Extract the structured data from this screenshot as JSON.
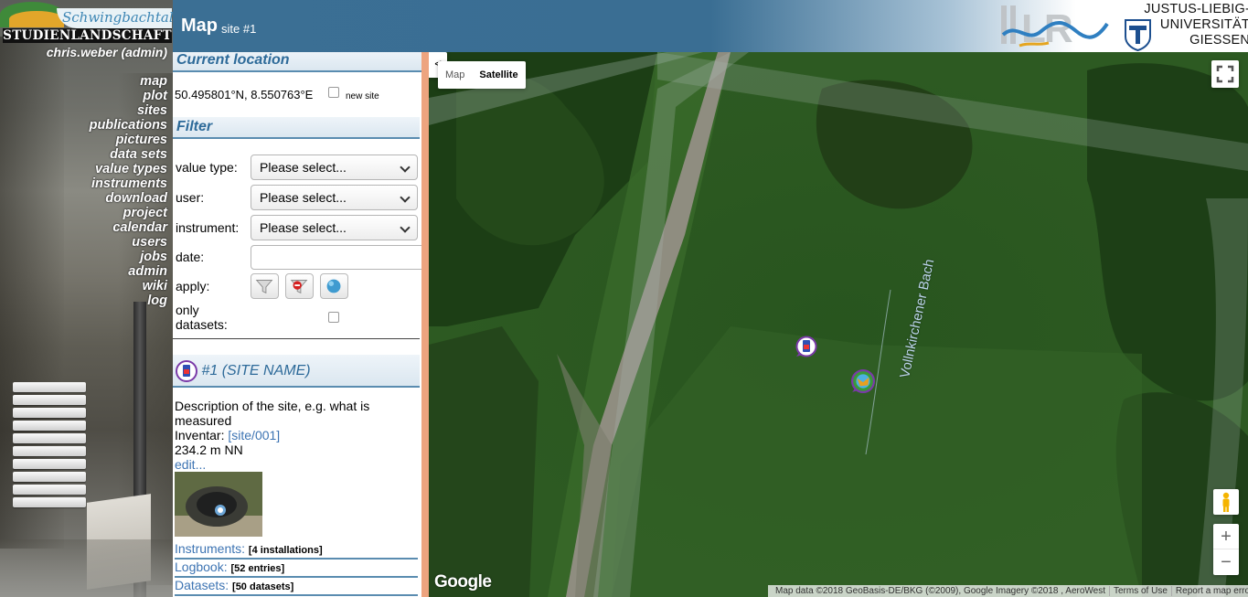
{
  "logo": {
    "script_text": "Schwingbachtal",
    "word_text": "STUDIENLANDSCHAFT"
  },
  "user": "chris.weber (admin)",
  "nav": [
    "map",
    "plot",
    "sites",
    "publications",
    "pictures",
    "data sets",
    "value types",
    "instruments",
    "download",
    "project",
    "calendar",
    "users",
    "jobs",
    "admin",
    "wiki",
    "log"
  ],
  "header": {
    "title": "Map",
    "subtitle": "site #1",
    "university": [
      "JUSTUS-LIEBIG-",
      "UNIVERSITÄT",
      "GIESSEN"
    ]
  },
  "current_location": {
    "heading": "Current location",
    "coords": "50.495801°N, 8.550763°E",
    "new_site_label": "new site"
  },
  "filter": {
    "heading": "Filter",
    "value_type_label": "value type:",
    "user_label": "user:",
    "instrument_label": "instrument:",
    "date_label": "date:",
    "apply_label": "apply:",
    "only_datasets_label": [
      "only",
      "datasets:"
    ],
    "select_placeholder": "Please select...",
    "date_value": ""
  },
  "site": {
    "title": "#1 (SITE NAME)",
    "description": "Description of the site, e.g. what is measured",
    "inventar_label": "Inventar:",
    "inventar_link": "[site/001]",
    "elevation": "234.2 m NN",
    "edit_link": "edit...",
    "sections": [
      {
        "label": "Instruments:",
        "count": "[4 installations]"
      },
      {
        "label": "Logbook:",
        "count": "[52 entries]"
      },
      {
        "label": "Datasets:",
        "count": "[50 datasets]"
      }
    ]
  },
  "map": {
    "collapse_glyph": "<",
    "type_map": "Map",
    "type_satellite": "Satellite",
    "stream_label": "Vollnkirchener Bach",
    "google_logo": "Google",
    "attribution": [
      "Map data ©2018 GeoBasis-DE/BKG (©2009), Google Imagery ©2018 , AeroWest",
      "Terms of Use",
      "Report a map error"
    ],
    "zoom_in": "+",
    "zoom_out": "−"
  }
}
